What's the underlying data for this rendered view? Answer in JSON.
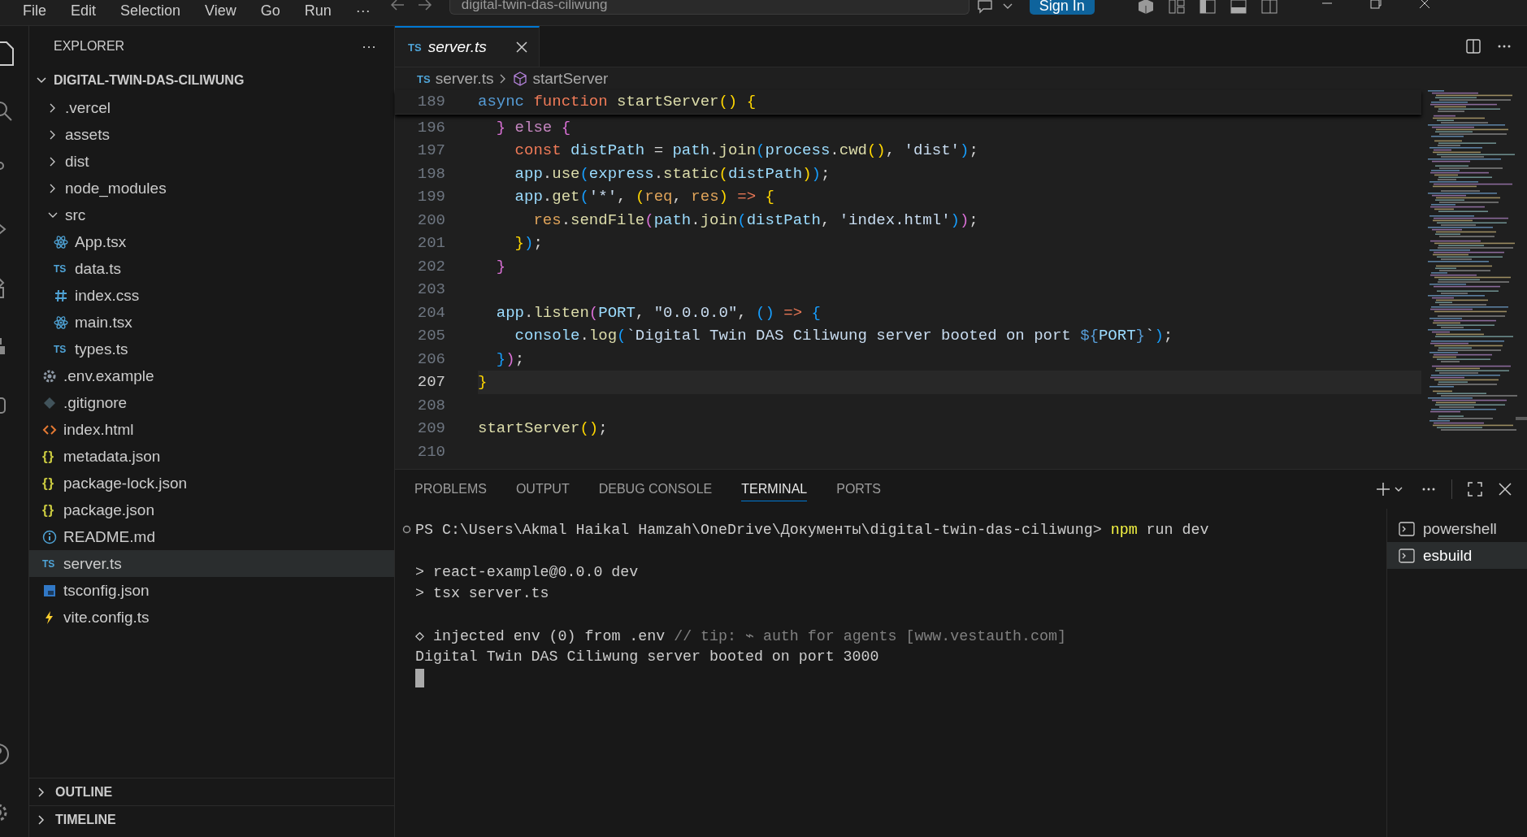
{
  "title_bar": {
    "menu": [
      "File",
      "Edit",
      "Selection",
      "View",
      "Go",
      "Run",
      "···"
    ],
    "search": {
      "value": "digital-twin-das-ciliwung"
    },
    "sign_in": "Sign In"
  },
  "explorer": {
    "title": "EXPLORER",
    "more": "···",
    "root": {
      "label": "DIGITAL-TWIN-DAS-CILIWUNG",
      "expanded": true,
      "children": [
        {
          "label": ".vercel",
          "kind": "folder",
          "expanded": false,
          "selected": false
        },
        {
          "label": "assets",
          "kind": "folder",
          "expanded": false,
          "selected": false
        },
        {
          "label": "dist",
          "kind": "folder",
          "expanded": false,
          "selected": false
        },
        {
          "label": "node_modules",
          "kind": "folder",
          "expanded": false,
          "selected": false
        },
        {
          "label": "src",
          "kind": "folder",
          "expanded": true,
          "selected": false,
          "children": [
            {
              "label": "App.tsx",
              "kind": "react",
              "selected": false
            },
            {
              "label": "data.ts",
              "kind": "ts",
              "badge": "TS",
              "selected": false
            },
            {
              "label": "index.css",
              "kind": "css",
              "selected": false
            },
            {
              "label": "main.tsx",
              "kind": "react",
              "selected": false
            },
            {
              "label": "types.ts",
              "kind": "ts",
              "badge": "TS",
              "selected": false
            }
          ]
        },
        {
          "label": ".env.example",
          "kind": "gear",
          "selected": false
        },
        {
          "label": ".gitignore",
          "kind": "git",
          "selected": false
        },
        {
          "label": "index.html",
          "kind": "html",
          "selected": false
        },
        {
          "label": "metadata.json",
          "kind": "json",
          "badge": "{}",
          "selected": false
        },
        {
          "label": "package-lock.json",
          "kind": "json",
          "badge": "{}",
          "selected": false
        },
        {
          "label": "package.json",
          "kind": "json",
          "badge": "{}",
          "selected": false
        },
        {
          "label": "README.md",
          "kind": "info",
          "selected": false
        },
        {
          "label": "server.ts",
          "kind": "ts",
          "badge": "TS",
          "selected": true
        },
        {
          "label": "tsconfig.json",
          "kind": "tsconfig",
          "selected": false
        },
        {
          "label": "vite.config.ts",
          "kind": "vite",
          "selected": false
        }
      ]
    },
    "sections": [
      {
        "label": "OUTLINE",
        "expanded": false
      },
      {
        "label": "TIMELINE",
        "expanded": false
      }
    ]
  },
  "editor": {
    "tabs": [
      {
        "badge": "TS",
        "label": "server.ts",
        "selected": true
      }
    ],
    "breadcrumbs": {
      "badge": "TS",
      "file": "server.ts",
      "symbol": "startServer"
    },
    "sticky_line": {
      "number": "189",
      "tokens": [
        {
          "t": "async ",
          "kind": "keyword"
        },
        {
          "t": "function ",
          "kind": "storage"
        },
        {
          "t": "startServer",
          "kind": "function"
        },
        {
          "t": "() {",
          "kind": "bracket1"
        }
      ]
    },
    "lines": [
      {
        "number": "196",
        "current": false,
        "tokens": [
          {
            "t": "  }",
            "kind": "bracket2"
          },
          {
            "t": " else",
            "kind": "control"
          },
          {
            "t": " {",
            "kind": "bracket2"
          }
        ]
      },
      {
        "number": "197",
        "current": false,
        "tokens": [
          {
            "t": "    const",
            "kind": "storage"
          },
          {
            "t": " distPath",
            "kind": "variable"
          },
          {
            "t": " = ",
            "kind": "plain"
          },
          {
            "t": "path",
            "kind": "variable"
          },
          {
            "t": ".",
            "kind": "plain"
          },
          {
            "t": "join",
            "kind": "function"
          },
          {
            "t": "(",
            "kind": "bracket3"
          },
          {
            "t": "process",
            "kind": "variable"
          },
          {
            "t": ".",
            "kind": "plain"
          },
          {
            "t": "cwd",
            "kind": "function"
          },
          {
            "t": "()",
            "kind": "bracket1"
          },
          {
            "t": ", ",
            "kind": "plain"
          },
          {
            "t": "'dist'",
            "kind": "string"
          },
          {
            "t": ")",
            "kind": "bracket3"
          },
          {
            "t": ";",
            "kind": "plain"
          }
        ]
      },
      {
        "number": "198",
        "current": false,
        "tokens": [
          {
            "t": "    app",
            "kind": "variable"
          },
          {
            "t": ".",
            "kind": "plain"
          },
          {
            "t": "use",
            "kind": "function"
          },
          {
            "t": "(",
            "kind": "bracket3"
          },
          {
            "t": "express",
            "kind": "variable"
          },
          {
            "t": ".",
            "kind": "plain"
          },
          {
            "t": "static",
            "kind": "function"
          },
          {
            "t": "(",
            "kind": "bracket1"
          },
          {
            "t": "distPath",
            "kind": "variable"
          },
          {
            "t": ")",
            "kind": "bracket1"
          },
          {
            "t": ")",
            "kind": "bracket3"
          },
          {
            "t": ";",
            "kind": "plain"
          }
        ]
      },
      {
        "number": "199",
        "current": false,
        "tokens": [
          {
            "t": "    app",
            "kind": "variable"
          },
          {
            "t": ".",
            "kind": "plain"
          },
          {
            "t": "get",
            "kind": "function"
          },
          {
            "t": "(",
            "kind": "bracket3"
          },
          {
            "t": "'*'",
            "kind": "string"
          },
          {
            "t": ", ",
            "kind": "plain"
          },
          {
            "t": "(",
            "kind": "bracket1"
          },
          {
            "t": "req",
            "kind": "parameter"
          },
          {
            "t": ", ",
            "kind": "plain"
          },
          {
            "t": "res",
            "kind": "parameter"
          },
          {
            "t": ")",
            "kind": "bracket1"
          },
          {
            "t": " =>",
            "kind": "storage"
          },
          {
            "t": " {",
            "kind": "bracket1"
          }
        ]
      },
      {
        "number": "200",
        "current": false,
        "tokens": [
          {
            "t": "      res",
            "kind": "parameter"
          },
          {
            "t": ".",
            "kind": "plain"
          },
          {
            "t": "sendFile",
            "kind": "function"
          },
          {
            "t": "(",
            "kind": "bracket2"
          },
          {
            "t": "path",
            "kind": "variable"
          },
          {
            "t": ".",
            "kind": "plain"
          },
          {
            "t": "join",
            "kind": "function"
          },
          {
            "t": "(",
            "kind": "bracket3"
          },
          {
            "t": "distPath",
            "kind": "variable"
          },
          {
            "t": ", ",
            "kind": "plain"
          },
          {
            "t": "'index.html'",
            "kind": "string"
          },
          {
            "t": ")",
            "kind": "bracket3"
          },
          {
            "t": ")",
            "kind": "bracket2"
          },
          {
            "t": ";",
            "kind": "plain"
          }
        ]
      },
      {
        "number": "201",
        "current": false,
        "tokens": [
          {
            "t": "    }",
            "kind": "bracket1"
          },
          {
            "t": ")",
            "kind": "bracket3"
          },
          {
            "t": ";",
            "kind": "plain"
          }
        ]
      },
      {
        "number": "202",
        "current": false,
        "tokens": [
          {
            "t": "  }",
            "kind": "bracket2"
          }
        ]
      },
      {
        "number": "203",
        "current": false
      },
      {
        "number": "204",
        "current": false,
        "tokens": [
          {
            "t": "  app",
            "kind": "variable"
          },
          {
            "t": ".",
            "kind": "plain"
          },
          {
            "t": "listen",
            "kind": "function"
          },
          {
            "t": "(",
            "kind": "bracket2"
          },
          {
            "t": "PORT",
            "kind": "variable"
          },
          {
            "t": ", ",
            "kind": "plain"
          },
          {
            "t": "\"0.0.0.0\"",
            "kind": "string"
          },
          {
            "t": ", ",
            "kind": "plain"
          },
          {
            "t": "()",
            "kind": "bracket3"
          },
          {
            "t": " =>",
            "kind": "storage"
          },
          {
            "t": " {",
            "kind": "bracket3"
          }
        ]
      },
      {
        "number": "205",
        "current": false,
        "tokens": [
          {
            "t": "    console",
            "kind": "variable"
          },
          {
            "t": ".",
            "kind": "plain"
          },
          {
            "t": "log",
            "kind": "function"
          },
          {
            "t": "(",
            "kind": "bracket3"
          },
          {
            "t": "`Digital Twin DAS Ciliwung server booted on port ",
            "kind": "string"
          },
          {
            "t": "${",
            "kind": "keyword"
          },
          {
            "t": "PORT",
            "kind": "variable"
          },
          {
            "t": "}",
            "kind": "keyword"
          },
          {
            "t": "`",
            "kind": "string"
          },
          {
            "t": ")",
            "kind": "bracket3"
          },
          {
            "t": ";",
            "kind": "plain"
          }
        ]
      },
      {
        "number": "206",
        "current": false,
        "tokens": [
          {
            "t": "  }",
            "kind": "bracket3"
          },
          {
            "t": ")",
            "kind": "bracket2"
          },
          {
            "t": ";",
            "kind": "plain"
          }
        ]
      },
      {
        "number": "207",
        "current": true,
        "tokens": [
          {
            "t": "}",
            "kind": "bracket1"
          }
        ]
      },
      {
        "number": "208",
        "current": false
      },
      {
        "number": "209",
        "current": false,
        "tokens": [
          {
            "t": "startServer",
            "kind": "function"
          },
          {
            "t": "()",
            "kind": "bracket1"
          },
          {
            "t": ";",
            "kind": "plain"
          }
        ]
      },
      {
        "number": "210",
        "current": false
      }
    ]
  },
  "panel": {
    "tabs": [
      {
        "label": "PROBLEMS",
        "selected": false
      },
      {
        "label": "OUTPUT",
        "selected": false
      },
      {
        "label": "DEBUG CONSOLE",
        "selected": false
      },
      {
        "label": "TERMINAL",
        "selected": true
      },
      {
        "label": "PORTS",
        "selected": false
      }
    ],
    "terminal": {
      "lines": [
        {
          "marker": true,
          "segments": [
            {
              "t": "PS C:\\Users\\Akmal Haikal Hamzah\\OneDrive\\Документы\\digital-twin-das-ciliwung>",
              "kind": "plain"
            },
            {
              "t": " npm",
              "kind": "command"
            },
            {
              "t": " run dev",
              "kind": "plain"
            }
          ]
        },
        {
          "marker": false
        },
        {
          "marker": false,
          "segments": [
            {
              "t": "> react-example@0.0.0 dev",
              "kind": "plain"
            }
          ]
        },
        {
          "marker": false,
          "segments": [
            {
              "t": "> tsx server.ts",
              "kind": "plain"
            }
          ]
        },
        {
          "marker": false
        },
        {
          "marker": false,
          "segments": [
            {
              "t": "◇ injected env (0) from .env",
              "kind": "plain"
            },
            {
              "t": " // tip: ⌁ auth for agents [www.vestauth.com]",
              "kind": "comment"
            }
          ]
        },
        {
          "marker": false,
          "segments": [
            {
              "t": "Digital Twin DAS Ciliwung server booted on port 3000",
              "kind": "plain"
            }
          ]
        }
      ],
      "cursor": true
    },
    "instances": [
      {
        "label": "powershell",
        "selected": false
      },
      {
        "label": "esbuild",
        "selected": true
      }
    ]
  }
}
